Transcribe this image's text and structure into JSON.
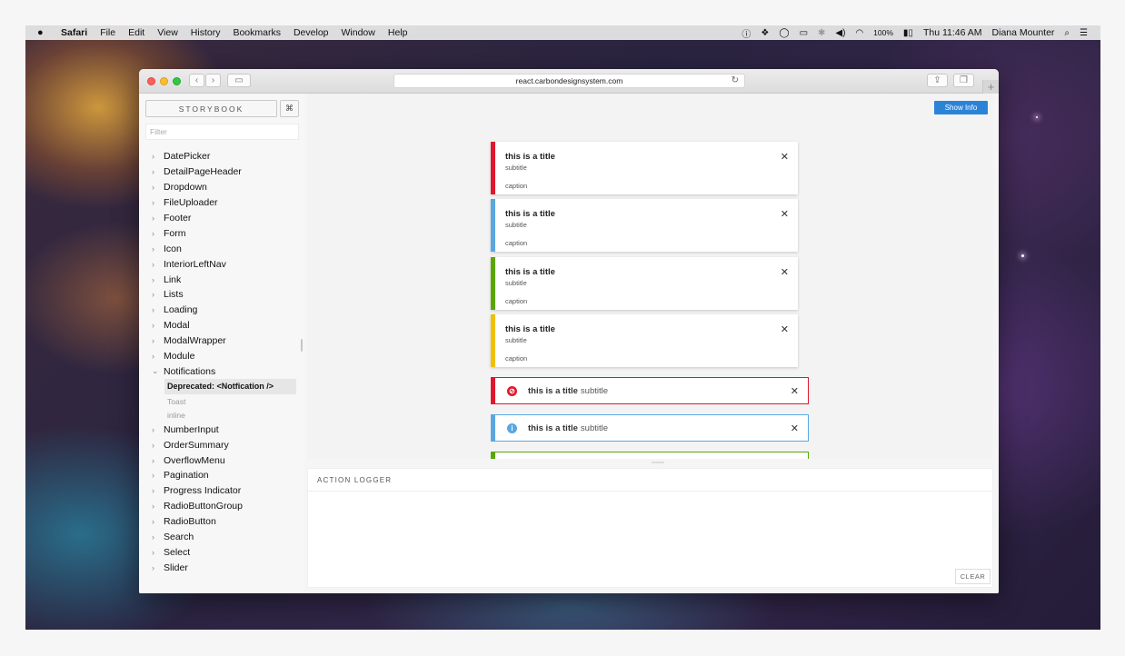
{
  "menubar": {
    "apple": "",
    "items": [
      "Safari",
      "File",
      "Edit",
      "View",
      "History",
      "Bookmarks",
      "Develop",
      "Window",
      "Help"
    ],
    "battery": "100%",
    "clock": "Thu 11:46 AM",
    "user": "Diana Mounter"
  },
  "browser": {
    "url": "react.carbondesignsystem.com",
    "new_tab": "+"
  },
  "sidebar": {
    "title": "STORYBOOK",
    "shortcut": "⌘",
    "filter_placeholder": "Filter",
    "items_before": [
      "DatePicker",
      "DetailPageHeader",
      "Dropdown",
      "FileUploader",
      "Footer",
      "Form",
      "Icon",
      "InteriorLeftNav",
      "Link",
      "Lists",
      "Loading",
      "Modal",
      "ModalWrapper",
      "Module"
    ],
    "expanded_item": "Notifications",
    "sub_active": "Deprecated: <Notfication />",
    "sub_items": [
      "Toast",
      "inline"
    ],
    "items_after": [
      "NumberInput",
      "OrderSummary",
      "OverflowMenu",
      "Pagination",
      "Progress Indicator",
      "RadioButtonGroup",
      "RadioButton",
      "Search",
      "Select",
      "Slider"
    ]
  },
  "preview": {
    "show_info": "Show Info",
    "toasts": [
      {
        "title": "this is a title",
        "subtitle": "subtitle",
        "caption": "caption",
        "color": "#e0182d"
      },
      {
        "title": "this is a title",
        "subtitle": "subtitle",
        "caption": "caption",
        "color": "#5aa7e0"
      },
      {
        "title": "this is a title",
        "subtitle": "subtitle",
        "caption": "caption",
        "color": "#5aa700"
      },
      {
        "title": "this is a title",
        "subtitle": "subtitle",
        "caption": "caption",
        "color": "#efc100"
      }
    ],
    "inline": [
      {
        "title": "this is a title",
        "subtitle": "subtitle",
        "color": "#e0182d",
        "icon": "error-icon"
      },
      {
        "title": "this is a title",
        "subtitle": "subtitle",
        "color": "#5aa7e0",
        "icon": "info-icon"
      }
    ],
    "close_glyph": "✕"
  },
  "logger": {
    "title": "ACTION LOGGER",
    "clear": "CLEAR"
  }
}
